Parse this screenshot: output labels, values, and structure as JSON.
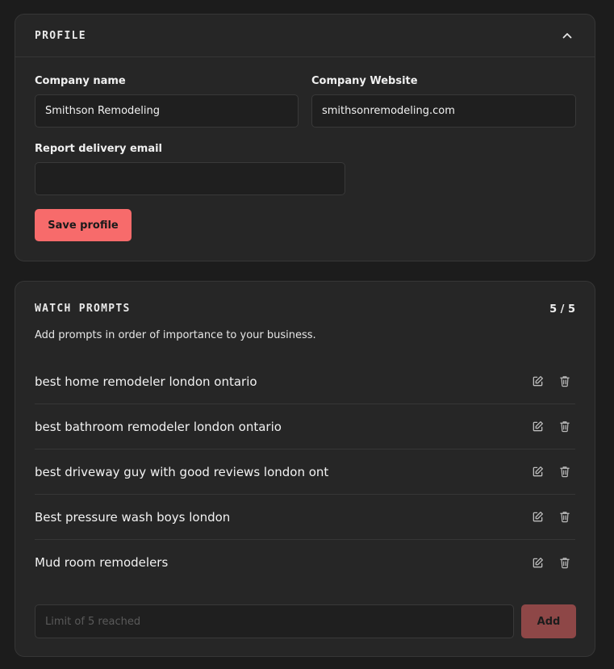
{
  "profile": {
    "title": "PROFILE",
    "company_name_label": "Company name",
    "company_name_value": "Smithson Remodeling",
    "website_label": "Company Website",
    "website_value": "smithsonremodeling.com",
    "email_label": "Report delivery email",
    "email_value": "",
    "save_label": "Save profile"
  },
  "prompts": {
    "title": "WATCH PROMPTS",
    "count": "5 / 5",
    "subtitle": "Add prompts in order of importance to your business.",
    "items": [
      "best home remodeler london ontario",
      "best bathroom remodeler london ontario",
      "best driveway guy with good reviews london ont",
      "Best pressure wash boys london",
      "Mud room remodelers"
    ],
    "new_prompt_placeholder": "Limit of 5 reached",
    "add_label": "Add"
  },
  "icons": {
    "collapse": "chevron-up-icon",
    "edit": "edit-icon",
    "delete": "trash-icon"
  },
  "colors": {
    "background": "#1c1c1c",
    "card": "#262626",
    "accent": "#f76b6b",
    "accent_disabled": "#8e4747"
  }
}
